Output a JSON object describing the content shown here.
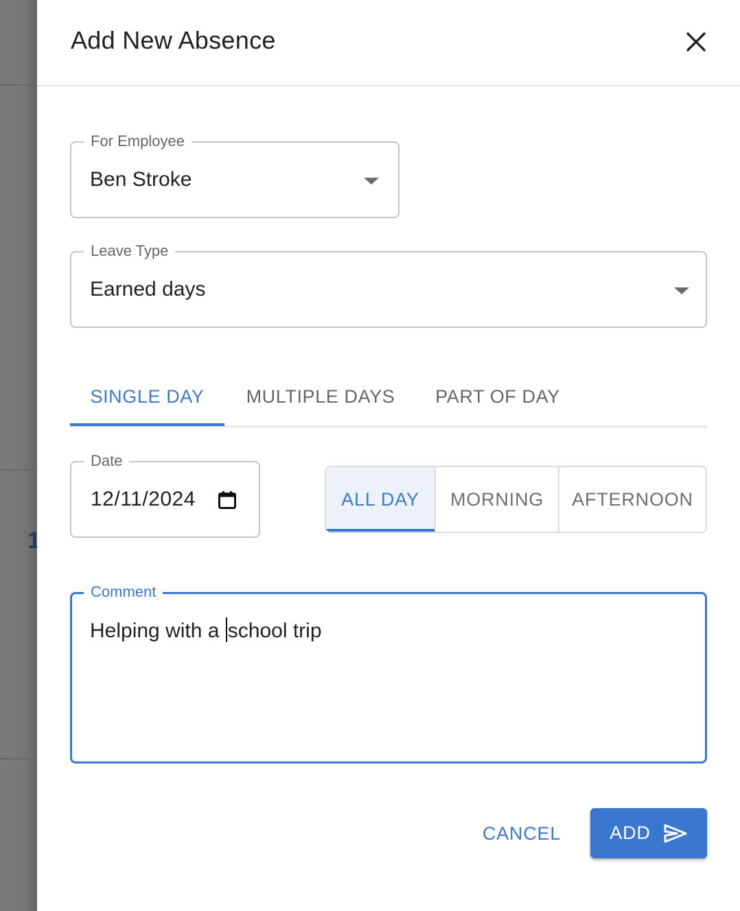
{
  "background": {
    "partial_text": "1"
  },
  "dialog": {
    "title": "Add New Absence",
    "close_icon": "close-icon"
  },
  "form": {
    "employee": {
      "label": "For Employee",
      "value": "Ben Stroke",
      "icon": "dropdown-arrow-icon"
    },
    "leave_type": {
      "label": "Leave Type",
      "value": "Earned days",
      "icon": "dropdown-arrow-icon"
    },
    "duration_tabs": [
      {
        "label": "SINGLE DAY",
        "active": true
      },
      {
        "label": "MULTIPLE DAYS",
        "active": false
      },
      {
        "label": "PART OF DAY",
        "active": false
      }
    ],
    "date": {
      "label": "Date",
      "value": "12/11/2024",
      "icon": "calendar-icon"
    },
    "day_portion": [
      {
        "label": "ALL DAY",
        "active": true
      },
      {
        "label": "MORNING",
        "active": false
      },
      {
        "label": "AFTERNOON",
        "active": false
      }
    ],
    "comment": {
      "label": "Comment",
      "value_before_cursor": "Helping with a ",
      "value_after_cursor": "school trip"
    }
  },
  "actions": {
    "cancel_label": "CANCEL",
    "add_label": "ADD",
    "add_icon": "send-icon"
  },
  "colors": {
    "accent": "#3a78cf",
    "text_primary": "#212121",
    "text_secondary": "#666666",
    "border": "#c4c4c4",
    "active_toggle_bg": "#edf2fa"
  }
}
